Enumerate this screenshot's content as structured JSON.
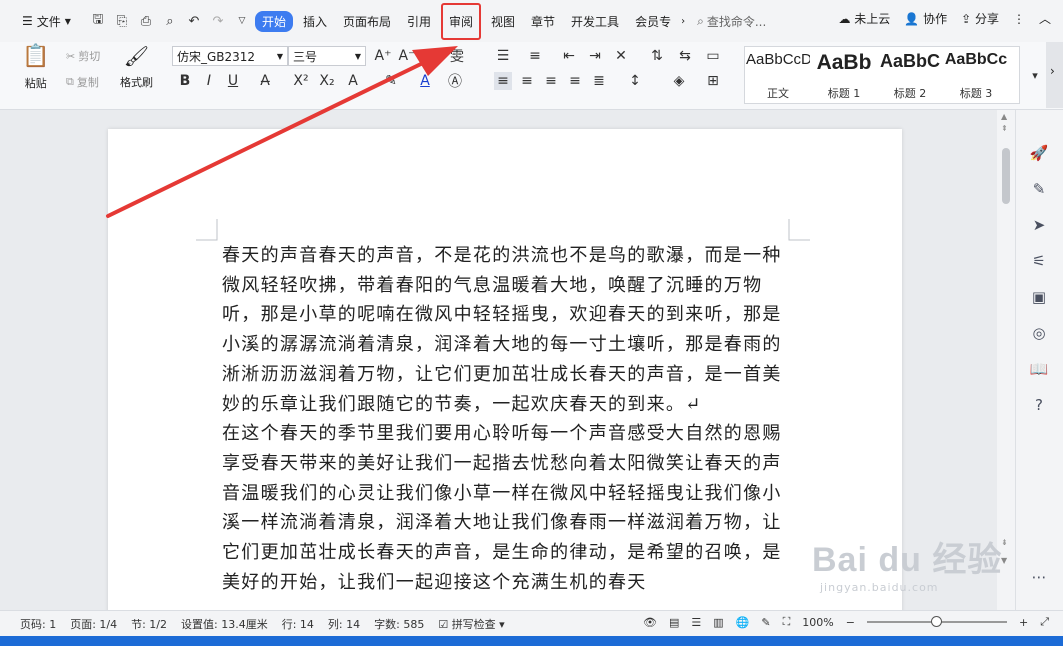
{
  "tabbar": {
    "file_label": "文件",
    "tabs": [
      {
        "label": "开始",
        "active": true
      },
      {
        "label": "插入"
      },
      {
        "label": "页面布局"
      },
      {
        "label": "引用"
      },
      {
        "label": "审阅",
        "highlighted": true
      },
      {
        "label": "视图"
      },
      {
        "label": "章节"
      },
      {
        "label": "开发工具"
      },
      {
        "label": "会员专"
      }
    ],
    "search_placeholder": "查找命令...",
    "cloud_label": "未上云",
    "collab_label": "协作",
    "share_label": "分享"
  },
  "ribbon": {
    "paste_label": "粘贴",
    "cut_label": "剪切",
    "copy_label": "复制",
    "format_painter_label": "格式刷",
    "font_name": "仿宋_GB2312",
    "font_size": "三号",
    "styles": [
      {
        "sample": "AaBbCcDd",
        "label": "正文"
      },
      {
        "sample": "AaBb",
        "label": "标题 1"
      },
      {
        "sample": "AaBbC",
        "label": "标题 2"
      },
      {
        "sample": "AaBbCc",
        "label": "标题 3"
      }
    ]
  },
  "document": {
    "paragraphs": [
      "春天的声音春天的声音，不是花的洪流也不是鸟的歌瀑，而是一种微风轻轻吹拂，带着春阳的气息温暖着大地，唤醒了沉睡的万物听，那是小草的呢喃在微风中轻轻摇曳，欢迎春天的到来听，那是小溪的潺潺流淌着清泉，润泽着大地的每一寸土壤听，那是春雨的淅淅沥沥滋润着万物，让它们更加茁壮成长春天的声音，是一首美妙的乐章让我们跟随它的节奏，一起欢庆春天的到来。↵",
      "在这个春天的季节里我们要用心聆听每一个声音感受大自然的恩赐享受春天带来的美好让我们一起揩去忧愁向着太阳微笑让春天的声音温暖我们的心灵让我们像小草一样在微风中轻轻摇曳让我们像小溪一样流淌着清泉，润泽着大地让我们像春雨一样滋润着万物，让它们更加茁壮成长春天的声音，是生命的律动，是希望的召唤，是美好的开始，让我们一起迎接这个充满生机的春天"
    ]
  },
  "statusbar": {
    "page_num": "页码: 1",
    "pages": "页面: 1/4",
    "section": "节: 1/2",
    "position": "设置值: 13.4厘米",
    "line": "行: 14",
    "column": "列: 14",
    "word_count": "字数: 585",
    "spell_check": "拼写检查",
    "zoom": "100%"
  },
  "watermark": {
    "main": "Bai du 经验",
    "sub": "jingyan.baidu.com"
  },
  "colors": {
    "accent": "#3d7cf0",
    "annotation": "#e53935"
  }
}
